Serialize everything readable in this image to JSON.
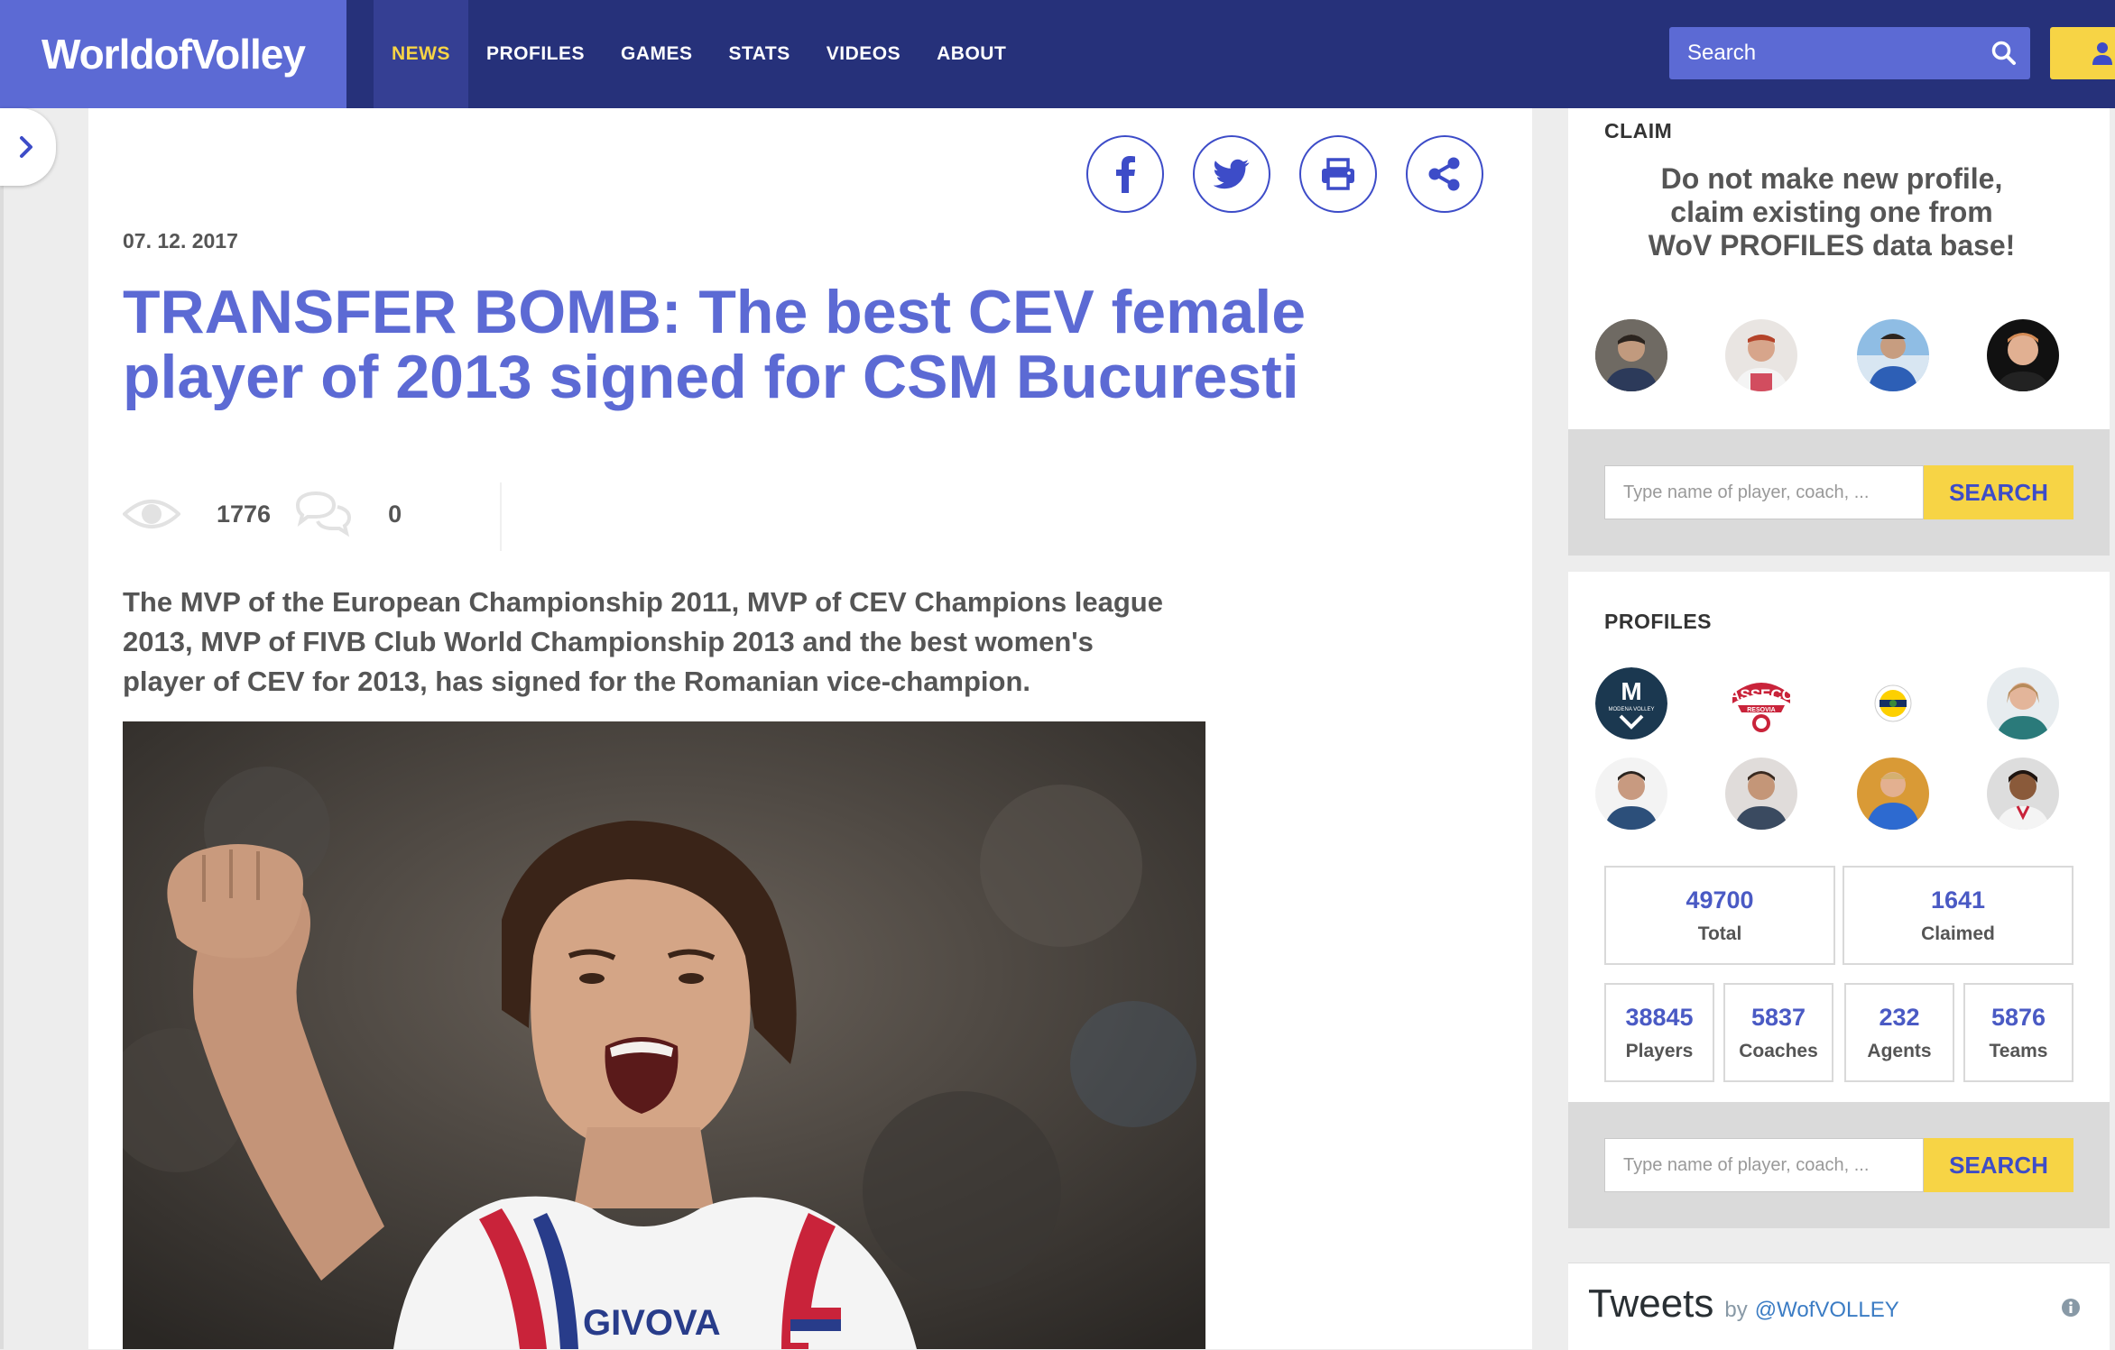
{
  "header": {
    "logo": "WorldofVolley",
    "nav": [
      {
        "label": "NEWS",
        "active": true
      },
      {
        "label": "PROFILES",
        "active": false
      },
      {
        "label": "GAMES",
        "active": false
      },
      {
        "label": "STATS",
        "active": false
      },
      {
        "label": "VIDEOS",
        "active": false
      },
      {
        "label": "ABOUT",
        "active": false
      }
    ],
    "search_placeholder": "Search",
    "search_icon": "search-icon",
    "user_icon": "user-icon"
  },
  "sidebar_toggle": {
    "icon": "chevron-right-icon"
  },
  "article": {
    "share_buttons": [
      {
        "name": "facebook",
        "icon": "facebook-icon"
      },
      {
        "name": "twitter",
        "icon": "twitter-icon"
      },
      {
        "name": "print",
        "icon": "print-icon"
      },
      {
        "name": "share",
        "icon": "share-icon"
      }
    ],
    "date": "07. 12. 2017",
    "title_lines": [
      "TRANSFER BOMB: The best CEV female",
      "player of 2013 signed for CSM Bucuresti"
    ],
    "views": "1776",
    "comments": "0",
    "lead_lines": [
      "The MVP of the European Championship 2011, MVP of CEV Champions league",
      "2013, MVP of FIVB Club World Championship 2013 and the best women's",
      "player of CEV for 2013, has signed for the Romanian vice-champion."
    ]
  },
  "claim": {
    "label": "CLAIM",
    "text_lines": [
      "Do not make new profile,",
      "claim existing one from",
      "WoV PROFILES data base!"
    ]
  },
  "search_strip": {
    "placeholder": "Type name of player, coach, ...",
    "button": "SEARCH"
  },
  "profiles": {
    "label": "PROFILES",
    "totals": [
      {
        "value": "49700",
        "label": "Total"
      },
      {
        "value": "1641",
        "label": "Claimed"
      }
    ],
    "breakdown": [
      {
        "value": "38845",
        "label": "Players"
      },
      {
        "value": "5837",
        "label": "Coaches"
      },
      {
        "value": "232",
        "label": "Agents"
      },
      {
        "value": "5876",
        "label": "Teams"
      }
    ],
    "logo_texts": {
      "modena_letter": "M",
      "modena_name": "MODENA VOLLEY",
      "asseco": "ASSECO",
      "resovia": "RESOVIA"
    }
  },
  "tweets": {
    "title": "Tweets",
    "by": "by",
    "handle": "@WofVOLLEY",
    "info_icon": "info-icon"
  },
  "photo": {
    "jersey_text": "GIVOVA"
  },
  "colors": {
    "navy": "#26317a",
    "brand_blue": "#5c6ad4",
    "accent_yellow": "#f7d445"
  }
}
